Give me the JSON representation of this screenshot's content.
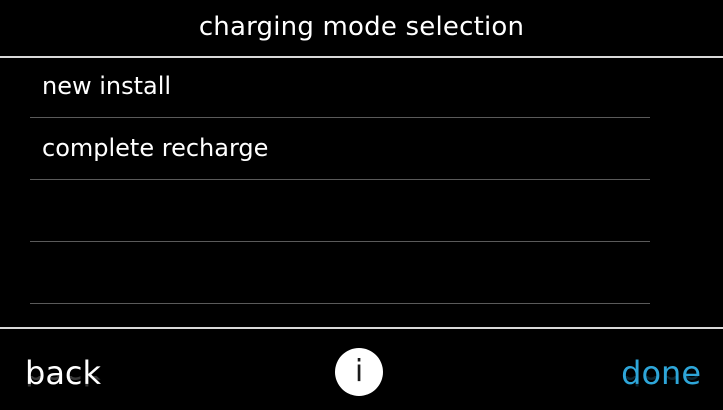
{
  "header": {
    "title": "charging mode selection"
  },
  "list": {
    "items": [
      {
        "label": "new install"
      },
      {
        "label": "complete recharge"
      },
      {
        "label": ""
      },
      {
        "label": ""
      }
    ]
  },
  "footer": {
    "back_label": "back",
    "info_glyph": "i",
    "info_icon": "info-icon",
    "done_label": "done"
  },
  "colors": {
    "background": "#000000",
    "text": "#ffffff",
    "accent": "#2ea6d9",
    "divider": "#5a5a5a"
  }
}
